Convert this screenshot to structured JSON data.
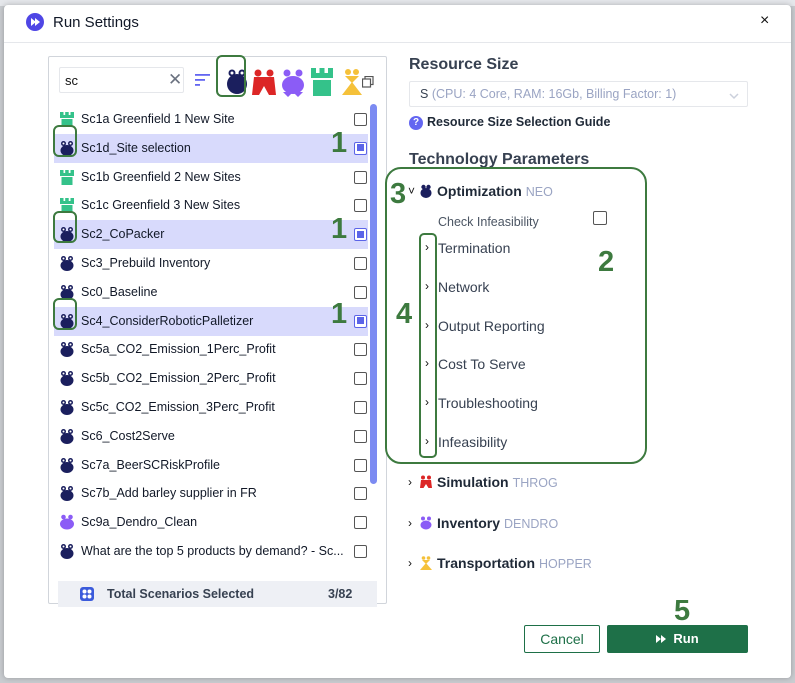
{
  "dialog": {
    "title": "Run Settings",
    "close": "×"
  },
  "search": {
    "value": "sc",
    "clear": "✕"
  },
  "colors": {
    "neo": "#1b1f5e",
    "throg": "#dc2626",
    "dendro": "#8b5cf6",
    "greenfield": "#34c28a",
    "hopper": "#f5c13a",
    "accent": "#5b64e8",
    "green": "#1e7048",
    "annotation": "#3d7a3f"
  },
  "scenarios": [
    {
      "label": "Sc1a Greenfield 1 New Site",
      "icon": "greenfield-icon",
      "selected": false
    },
    {
      "label": "Sc1d_Site selection",
      "icon": "neo-icon",
      "selected": true
    },
    {
      "label": "Sc1b Greenfield 2 New Sites",
      "icon": "greenfield-icon",
      "selected": false
    },
    {
      "label": "Sc1c Greenfield 3 New Sites",
      "icon": "greenfield-icon",
      "selected": false
    },
    {
      "label": "Sc2_CoPacker",
      "icon": "neo-icon",
      "selected": true
    },
    {
      "label": "Sc3_Prebuild Inventory",
      "icon": "neo-icon",
      "selected": false
    },
    {
      "label": "Sc0_Baseline",
      "icon": "neo-icon",
      "selected": false
    },
    {
      "label": "Sc4_ConsiderRoboticPalletizer",
      "icon": "neo-icon",
      "selected": true
    },
    {
      "label": "Sc5a_CO2_Emission_1Perc_Profit",
      "icon": "neo-icon",
      "selected": false
    },
    {
      "label": "Sc5b_CO2_Emission_2Perc_Profit",
      "icon": "neo-icon",
      "selected": false
    },
    {
      "label": "Sc5c_CO2_Emission_3Perc_Profit",
      "icon": "neo-icon",
      "selected": false
    },
    {
      "label": "Sc6_Cost2Serve",
      "icon": "neo-icon",
      "selected": false
    },
    {
      "label": "Sc7a_BeerSCRiskProfile",
      "icon": "neo-icon",
      "selected": false
    },
    {
      "label": "Sc7b_Add barley supplier in FR",
      "icon": "neo-icon",
      "selected": false
    },
    {
      "label": "Sc9a_Dendro_Clean",
      "icon": "dendro-icon",
      "selected": false
    },
    {
      "label": "What are the top 5 products by demand? - Sc...",
      "icon": "neo-icon",
      "selected": false
    }
  ],
  "footer": {
    "label": "Total Scenarios Selected",
    "count": "3/82"
  },
  "resource": {
    "title": "Resource Size",
    "size": "S",
    "detail": "(CPU: 4 Core, RAM: 16Gb, Billing Factor: 1)",
    "guide": "Resource Size Selection Guide",
    "guide_glyph": "?"
  },
  "tech": {
    "title": "Technology Parameters",
    "optimization": {
      "chev": "˅",
      "name": "Optimization",
      "tag": "NEO"
    },
    "check_infeasibility": "Check Infeasibility",
    "params": [
      "Termination",
      "Network",
      "Output Reporting",
      "Cost To Serve",
      "Troubleshooting",
      "Infeasibility"
    ],
    "simulation": {
      "chev": "›",
      "name": "Simulation",
      "tag": "THROG"
    },
    "inventory": {
      "chev": "›",
      "name": "Inventory",
      "tag": "DENDRO"
    },
    "transportation": {
      "chev": "›",
      "name": "Transportation",
      "tag": "HOPPER"
    }
  },
  "param_chev": "›",
  "buttons": {
    "cancel": "Cancel",
    "run": "Run"
  },
  "annotations": {
    "one": "1",
    "two": "2",
    "three": "3",
    "four": "4",
    "five": "5"
  }
}
